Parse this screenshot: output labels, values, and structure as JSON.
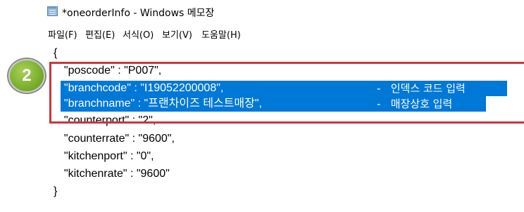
{
  "window": {
    "title": "*oneorderInfo - Windows 메모장"
  },
  "menu": {
    "items": [
      "파일(F)",
      "편집(E)",
      "서식(O)",
      "보기(V)",
      "도움말(H)"
    ]
  },
  "editor": {
    "lines": [
      "{",
      "  \"poscode\" : \"P007\",",
      "  \"branchcode\" : \"I19052200008\",",
      "  \"branchname\" : \"프랜차이즈 테스트매장\",",
      "  \"counterport\" : \"2\",",
      "  \"counterrate\" : \"9600\",",
      "  \"kitchenport\" : \"0\",",
      "  \"kitchenrate\" : \"9600\"",
      "}"
    ],
    "notes": {
      "branchcode": "-   인덱스 코드 입력",
      "branchname": "-   매장상호 입력"
    }
  },
  "annotation": {
    "step": "2",
    "highlight_color": "#c6383e",
    "selection_color": "#0078d7",
    "badge_color": "#7fb230"
  }
}
